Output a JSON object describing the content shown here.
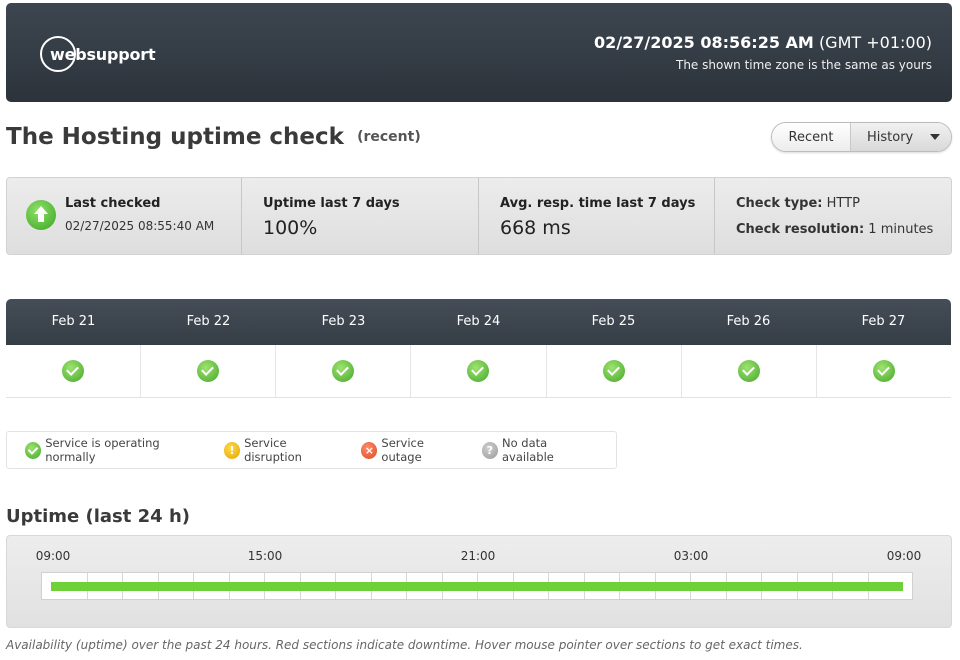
{
  "header": {
    "logo_text": "websupport",
    "datetime": "02/27/2025 08:56:25 AM",
    "timezone": "(GMT +01:00)",
    "timezone_note": "The shown time zone is the same as yours",
    "background": "#333a42"
  },
  "title": {
    "main": "The Hosting uptime check",
    "tag": "(recent)"
  },
  "view_switch": {
    "recent": "Recent",
    "history": "History",
    "selected": "Recent"
  },
  "stats": {
    "last_checked_label": "Last checked",
    "last_checked_value": "02/27/2025 08:55:40 AM",
    "uptime_label": "Uptime last 7 days",
    "uptime_value": "100%",
    "resp_label": "Avg. resp. time last 7 days",
    "resp_value": "668 ms",
    "check_type_label": "Check type:",
    "check_type_value": "HTTP",
    "check_resolution_label": "Check resolution:",
    "check_resolution_value": "1 minutes"
  },
  "calendar": {
    "days": [
      {
        "label": "Feb 21",
        "status": "ok"
      },
      {
        "label": "Feb 22",
        "status": "ok"
      },
      {
        "label": "Feb 23",
        "status": "ok"
      },
      {
        "label": "Feb 24",
        "status": "ok"
      },
      {
        "label": "Feb 25",
        "status": "ok"
      },
      {
        "label": "Feb 26",
        "status": "ok"
      },
      {
        "label": "Feb 27",
        "status": "ok"
      }
    ]
  },
  "legend": {
    "ok": "Service is operating normally",
    "disruption": "Service disruption",
    "outage": "Service outage",
    "no_data": "No data available"
  },
  "uptime24": {
    "title": "Uptime (last 24 h)",
    "time_labels": [
      "09:00",
      "15:00",
      "21:00",
      "03:00",
      "09:00"
    ],
    "uptime_fraction": 1.0,
    "bar_color": "#6fd13a",
    "caption": "Availability (uptime) over the past 24 hours. Red sections indicate downtime. Hover mouse pointer over sections to get exact times."
  }
}
